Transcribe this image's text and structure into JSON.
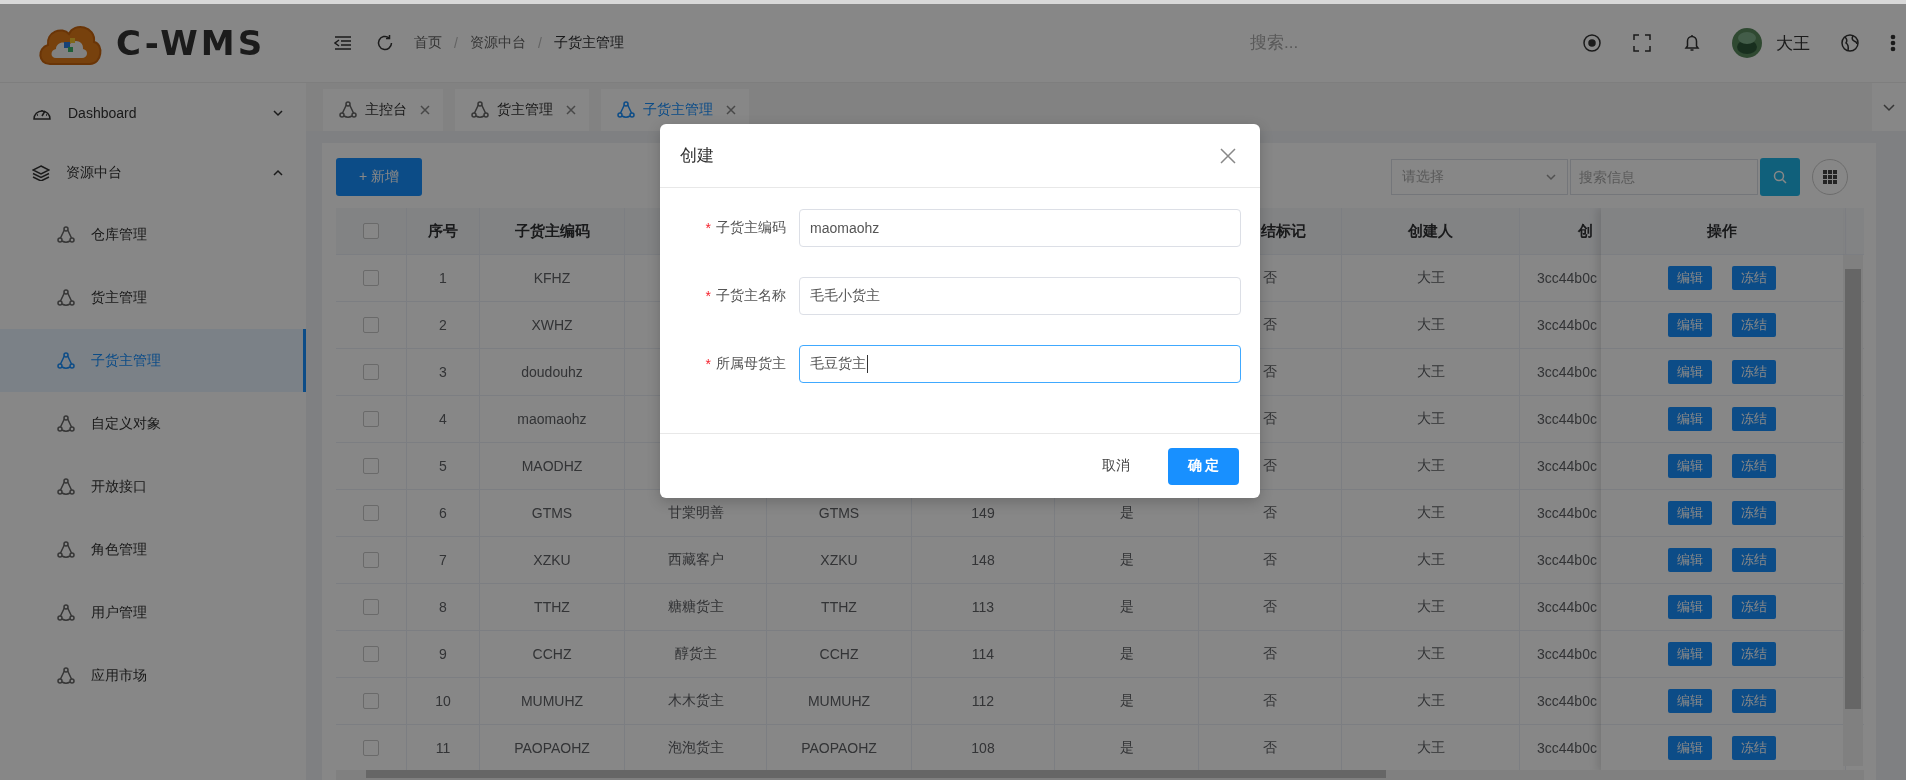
{
  "header": {
    "logo_text": "C-WMS",
    "breadcrumb": [
      {
        "label": "首页"
      },
      {
        "label": "资源中台"
      },
      {
        "label": "子货主管理"
      }
    ],
    "breadcrumb_separator": "/",
    "search": {
      "placeholder": "搜索..."
    },
    "user": {
      "name": "大王"
    }
  },
  "sidebar": {
    "items": [
      {
        "label": "Dashboard",
        "expanded": false,
        "selected": false
      },
      {
        "label": "资源中台",
        "expanded": true,
        "selected": false,
        "children": [
          {
            "label": "仓库管理",
            "selected": false
          },
          {
            "label": "货主管理",
            "selected": false
          },
          {
            "label": "子货主管理",
            "selected": true
          },
          {
            "label": "自定义对象",
            "selected": false
          },
          {
            "label": "开放接口",
            "selected": false
          },
          {
            "label": "角色管理",
            "selected": false
          },
          {
            "label": "用户管理",
            "selected": false
          },
          {
            "label": "应用市场",
            "selected": false
          }
        ]
      }
    ]
  },
  "tabs": [
    {
      "label": "主控台",
      "selected": false
    },
    {
      "label": "货主管理",
      "selected": false
    },
    {
      "label": "子货主管理",
      "selected": true
    }
  ],
  "toolbar": {
    "add_button": "+ 新增",
    "select": {
      "placeholder": "请选择"
    },
    "search": {
      "placeholder": "搜索信息"
    }
  },
  "table": {
    "all_checked": false,
    "columns": [
      "序号",
      "子货主编码",
      null,
      null,
      null,
      null,
      "结标记",
      "创建人",
      "创"
    ],
    "actions_column": "操作",
    "rows": [
      {
        "checked": false,
        "cells": [
          "1",
          "KFHZ",
          null,
          null,
          null,
          null,
          "否",
          "大王",
          "3cc44b0c"
        ],
        "actions": [
          "编辑",
          "冻结"
        ]
      },
      {
        "checked": false,
        "cells": [
          "2",
          "XWHZ",
          null,
          null,
          null,
          null,
          "否",
          "大王",
          "3cc44b0c"
        ],
        "actions": [
          "编辑",
          "冻结"
        ]
      },
      {
        "checked": false,
        "cells": [
          "3",
          "doudouhz",
          null,
          null,
          null,
          null,
          "否",
          "大王",
          "3cc44b0c"
        ],
        "actions": [
          "编辑",
          "冻结"
        ]
      },
      {
        "checked": false,
        "cells": [
          "4",
          "maomaohz",
          null,
          null,
          null,
          null,
          "否",
          "大王",
          "3cc44b0c"
        ],
        "actions": [
          "编辑",
          "冻结"
        ]
      },
      {
        "checked": false,
        "cells": [
          "5",
          "MAODHZ",
          null,
          null,
          null,
          null,
          "否",
          "大王",
          "3cc44b0c"
        ],
        "actions": [
          "编辑",
          "冻结"
        ]
      },
      {
        "checked": false,
        "cells": [
          "6",
          "GTMS",
          "甘棠明善",
          "GTMS",
          "149",
          "是",
          "否",
          "大王",
          "3cc44b0c"
        ],
        "actions": [
          "编辑",
          "冻结"
        ]
      },
      {
        "checked": false,
        "cells": [
          "7",
          "XZKU",
          "西藏客户",
          "XZKU",
          "148",
          "是",
          "否",
          "大王",
          "3cc44b0c"
        ],
        "actions": [
          "编辑",
          "冻结"
        ]
      },
      {
        "checked": false,
        "cells": [
          "8",
          "TTHZ",
          "糖糖货主",
          "TTHZ",
          "113",
          "是",
          "否",
          "大王",
          "3cc44b0c"
        ],
        "actions": [
          "编辑",
          "冻结"
        ]
      },
      {
        "checked": false,
        "cells": [
          "9",
          "CCHZ",
          "醇货主",
          "CCHZ",
          "114",
          "是",
          "否",
          "大王",
          "3cc44b0c"
        ],
        "actions": [
          "编辑",
          "冻结"
        ]
      },
      {
        "checked": false,
        "cells": [
          "10",
          "MUMUHZ",
          "木木货主",
          "MUMUHZ",
          "112",
          "是",
          "否",
          "大王",
          "3cc44b0c"
        ],
        "actions": [
          "编辑",
          "冻结"
        ]
      },
      {
        "checked": false,
        "cells": [
          "11",
          "PAOPAOHZ",
          "泡泡货主",
          "PAOPAOHZ",
          "108",
          "是",
          "否",
          "大王",
          "3cc44b0c"
        ],
        "actions": [
          "编辑",
          "冻结"
        ]
      }
    ]
  },
  "modal": {
    "title": "创建",
    "required_mark": "*",
    "fields": [
      {
        "label": "子货主编码",
        "required": true,
        "value": "maomaohz",
        "focused": false
      },
      {
        "label": "子货主名称",
        "required": true,
        "value": "毛毛小货主",
        "focused": false
      },
      {
        "label": "所属母货主",
        "required": true,
        "value": "毛豆货主",
        "focused": true
      }
    ],
    "cancel_button": "取消",
    "ok_button": "确 定"
  }
}
